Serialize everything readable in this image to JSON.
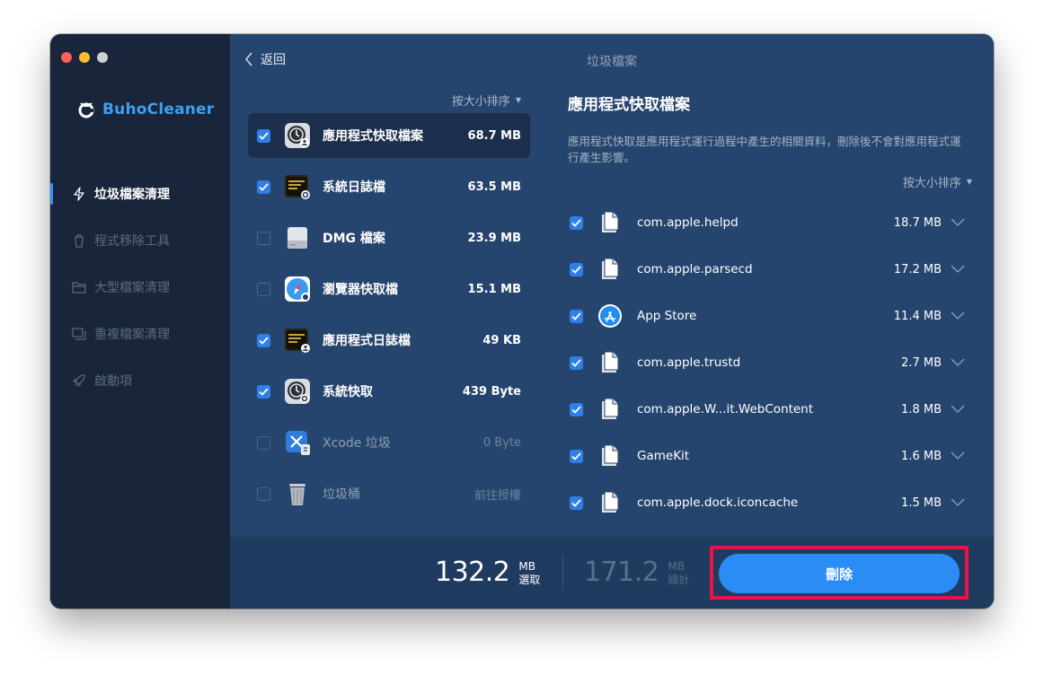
{
  "app": {
    "name": "BuhoCleaner",
    "window_title": "垃圾檔案"
  },
  "sidebar": {
    "items": [
      {
        "label": "垃圾檔案清理",
        "icon": "lightning-icon",
        "active": true
      },
      {
        "label": "程式移除工具",
        "icon": "trash-icon",
        "active": false
      },
      {
        "label": "大型檔案清理",
        "icon": "folder-icon",
        "active": false
      },
      {
        "label": "重複檔案清理",
        "icon": "duplicate-icon",
        "active": false
      },
      {
        "label": "啟動項",
        "icon": "rocket-icon",
        "active": false
      }
    ]
  },
  "toolbar": {
    "back_label": "返回"
  },
  "categories": {
    "sort_label": "按大小排序",
    "items": [
      {
        "name": "應用程式快取檔案",
        "size": "68.7 MB",
        "checked": true,
        "icon": "app-cache-icon"
      },
      {
        "name": "系統日誌檔",
        "size": "63.5 MB",
        "checked": true,
        "icon": "system-log-icon"
      },
      {
        "name": "DMG 檔案",
        "size": "23.9 MB",
        "checked": false,
        "icon": "disk-image-icon"
      },
      {
        "name": "瀏覽器快取檔",
        "size": "15.1 MB",
        "checked": false,
        "icon": "browser-cache-icon"
      },
      {
        "name": "應用程式日誌檔",
        "size": "49 KB",
        "checked": true,
        "icon": "app-log-icon"
      },
      {
        "name": "系統快取",
        "size": "439 Byte",
        "checked": true,
        "icon": "system-cache-icon"
      },
      {
        "name": "Xcode 垃圾",
        "size": "0 Byte",
        "checked": false,
        "icon": "xcode-icon"
      },
      {
        "name": "垃圾桶",
        "size": "前往授權",
        "checked": false,
        "icon": "trash-bin-icon"
      }
    ]
  },
  "detail": {
    "title": "應用程式快取檔案",
    "description": "應用程式快取是應用程式運行過程中產生的相關資料，刪除後不會對應用程式運行產生影響。",
    "sort_label": "按大小排序",
    "files": [
      {
        "name": "com.apple.helpd",
        "size": "18.7 MB",
        "icon": "document-icon"
      },
      {
        "name": "com.apple.parsecd",
        "size": "17.2 MB",
        "icon": "document-icon"
      },
      {
        "name": "App Store",
        "size": "11.4 MB",
        "icon": "app-store-icon"
      },
      {
        "name": "com.apple.trustd",
        "size": "2.7 MB",
        "icon": "document-icon"
      },
      {
        "name": "com.apple.W...it.WebContent",
        "size": "1.8 MB",
        "icon": "document-icon"
      },
      {
        "name": "GameKit",
        "size": "1.6 MB",
        "icon": "document-icon"
      },
      {
        "name": "com.apple.dock.iconcache",
        "size": "1.5 MB",
        "icon": "document-icon"
      }
    ]
  },
  "footer": {
    "selected_value": "132.2",
    "selected_unit": "MB",
    "selected_label": "選取",
    "total_value": "171.2",
    "total_unit": "MB",
    "total_label": "總計",
    "delete_label": "刪除"
  },
  "colors": {
    "accent": "#2b8cf5",
    "sidebar_bg": "#18253a",
    "main_bg": "#26456e",
    "highlight_frame": "#e5154a"
  }
}
